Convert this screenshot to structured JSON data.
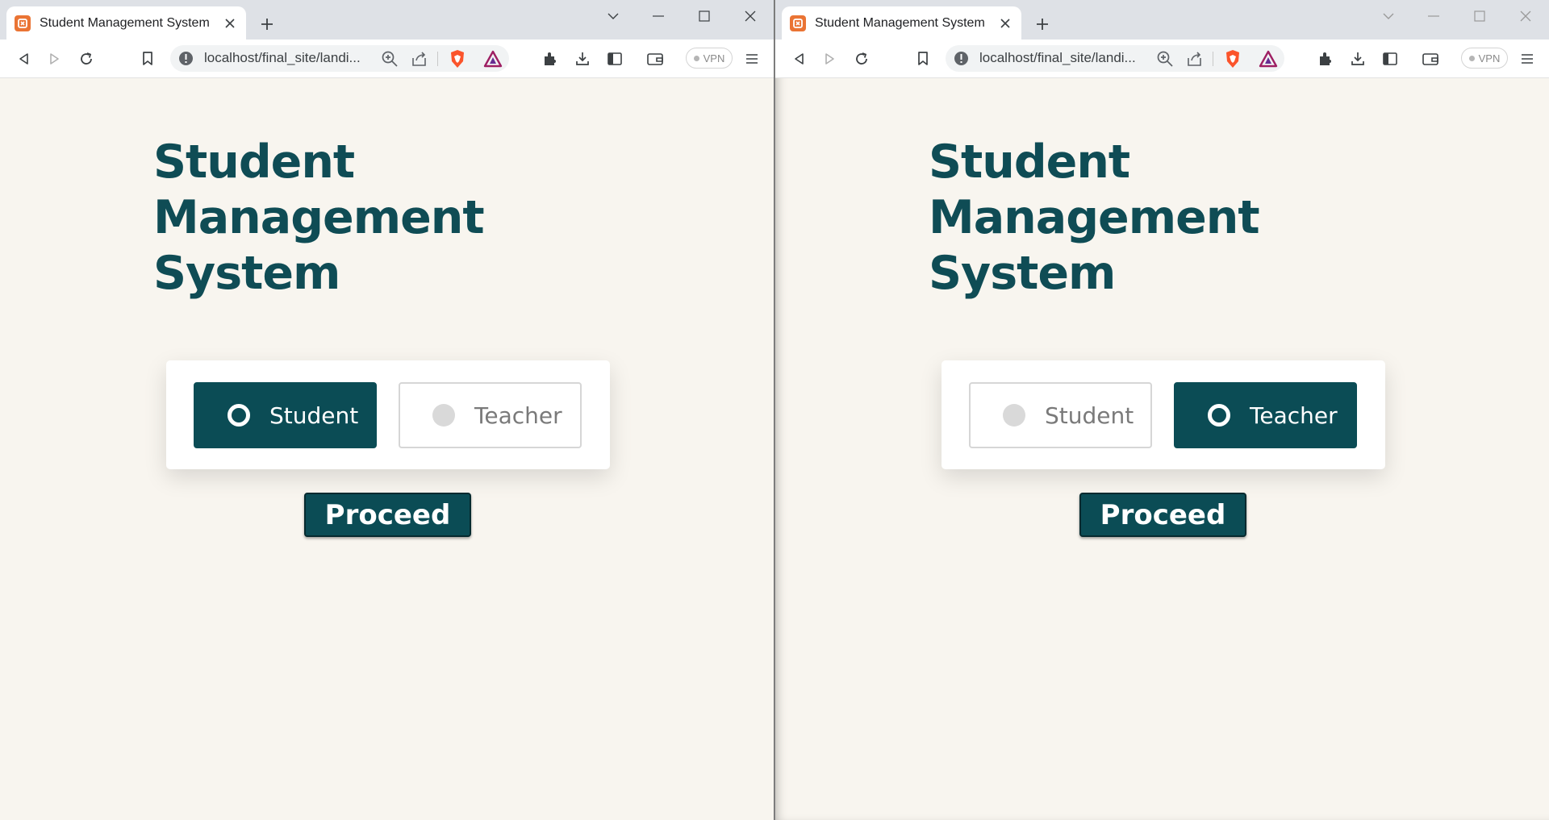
{
  "colors": {
    "brand_teal": "#0b4c55",
    "page_background": "#f8f5ef",
    "tab_strip": "#dee1e6",
    "favicon": "#ea7434"
  },
  "windows": [
    {
      "tab": {
        "title": "Student Management System",
        "favicon": "xampp-icon"
      },
      "address_bar": {
        "url": "localhost/final_site/landi..."
      },
      "vpn": {
        "label": "VPN"
      },
      "page": {
        "heading": "Student Management System",
        "options": [
          {
            "label": "Student",
            "selected": true
          },
          {
            "label": "Teacher",
            "selected": false
          }
        ],
        "proceed_label": "Proceed"
      }
    },
    {
      "tab": {
        "title": "Student Management System",
        "favicon": "xampp-icon"
      },
      "address_bar": {
        "url": "localhost/final_site/landi..."
      },
      "vpn": {
        "label": "VPN"
      },
      "page": {
        "heading": "Student Management System",
        "options": [
          {
            "label": "Student",
            "selected": false
          },
          {
            "label": "Teacher",
            "selected": true
          }
        ],
        "proceed_label": "Proceed"
      }
    }
  ]
}
